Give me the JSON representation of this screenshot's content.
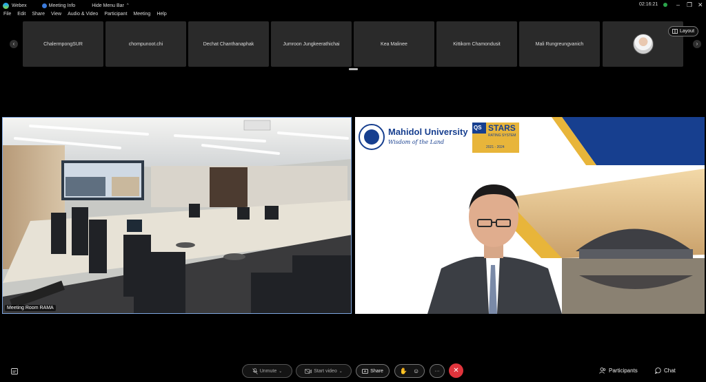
{
  "titlebar": {
    "app": "Webex",
    "meeting_info": "Meeting Info",
    "hide_menu_bar": "Hide Menu Bar",
    "caret": "^",
    "time": "02:16:21",
    "minimize": "–",
    "restore": "❐",
    "close": "✕"
  },
  "menu": [
    "File",
    "Edit",
    "Share",
    "View",
    "Audio & Video",
    "Participant",
    "Meeting",
    "Help"
  ],
  "strip": {
    "prev": "‹",
    "next": "›",
    "participants": [
      "ChalermpongSUR",
      "chompunoot.chi",
      "Dechat Chanthanaphak",
      "Jumroon Jungkeerathichai",
      "Kea Malinee",
      "Kittikorn Chamondusit",
      "Mali Rungreungvanich"
    ],
    "layout_label": "Layout",
    "layout_icon": "layout-grid-icon"
  },
  "videos": {
    "left_name": "Meeting Room RAMA",
    "slide_university": "Mahidol University",
    "slide_tagline": "Wisdom of the Land",
    "slide_qs": "QS",
    "slide_stars": "STARS",
    "slide_stars_sub": "RATING SYSTEM",
    "slide_years": "2021 - 2024"
  },
  "toolbar": {
    "unmute": "Unmute",
    "start_video": "Start video",
    "share": "Share",
    "more": "···",
    "end": "✕",
    "participants": "Participants",
    "chat": "Chat"
  },
  "colors": {
    "end_call": "#e0343c",
    "accent_blue": "#1a4aa8",
    "accent_gold": "#e8b53a"
  }
}
